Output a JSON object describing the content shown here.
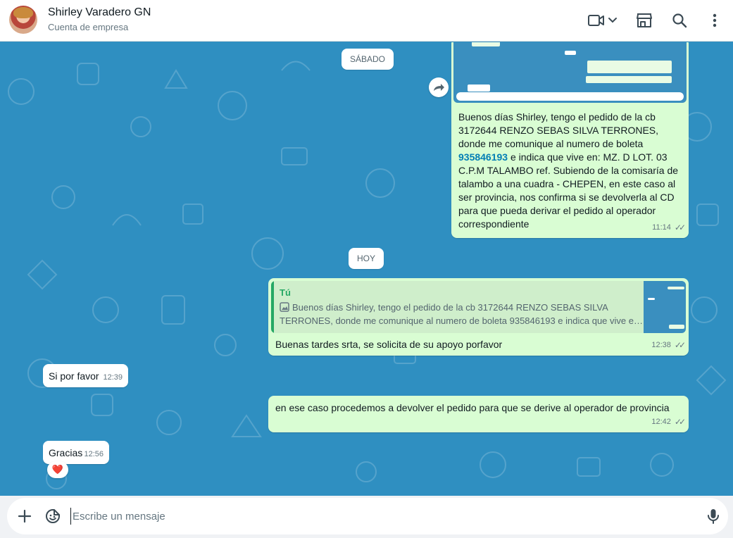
{
  "header": {
    "name": "Shirley Varadero GN",
    "subtitle": "Cuenta de empresa"
  },
  "dates": {
    "saturday": "SÁBADO",
    "today": "HOY"
  },
  "messages": {
    "m1": {
      "text_a": "Buenos días Shirley, tengo el pedido de la cb 3172644 RENZO SEBAS SILVA TERRONES, donde me comunique al numero de boleta ",
      "phone": "935846193",
      "text_b": " e indica que vive en: MZ. D LOT. 03 C.P.M TALAMBO ref. Subiendo de la comisaría de talambo a una cuadra - CHEPEN, en este caso al ser provincia, nos confirma si se devolverla al CD para que pueda derivar el pedido al operador correspondiente",
      "time": "11:14"
    },
    "m2": {
      "quote_author": "Tú",
      "quote_text": "Buenos días Shirley, tengo el pedido de la cb 3172644 RENZO SEBAS SILVA TERRONES, donde me comunique al numero de boleta 935846193 e indica que vive e…",
      "text": "Buenas tardes srta, se solicita de su apoyo porfavor",
      "time": "12:38"
    },
    "m3": {
      "text": "Si por favor",
      "time": "12:39"
    },
    "m4": {
      "text": "en ese caso procedemos a devolver el pedido para que se derive al operador de provincia",
      "time": "12:42"
    },
    "m5": {
      "text": "Gracias",
      "time": "12:56",
      "reaction": "❤️"
    }
  },
  "composer": {
    "placeholder": "Escribe un mensaje"
  },
  "colors": {
    "chat_bg": "#2f8fc1",
    "outgoing": "#d9fdd3",
    "incoming": "#ffffff",
    "accent": "#25a864"
  }
}
